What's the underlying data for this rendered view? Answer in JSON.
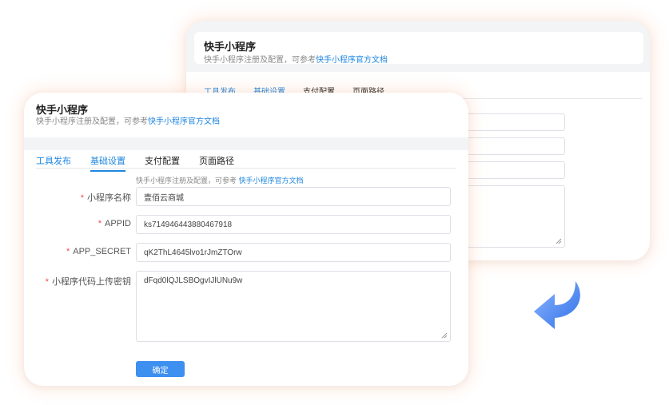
{
  "back_panel": {
    "title": "快手小程序",
    "subtitle_text": "快手小程序注册及配置，可参考",
    "subtitle_link": "快手小程序官方文档",
    "tabs": [
      {
        "label": "工具发布",
        "active": true
      },
      {
        "label": "基础设置",
        "active": false
      },
      {
        "label": "支付配置",
        "active": false
      },
      {
        "label": "页面路径",
        "active": false
      }
    ]
  },
  "front_panel": {
    "title": "快手小程序",
    "subtitle_text": "快手小程序注册及配置，可参考",
    "subtitle_link": "快手小程序官方文档",
    "tabs": [
      {
        "label": "工具发布",
        "active": false
      },
      {
        "label": "基础设置",
        "active": true
      },
      {
        "label": "支付配置",
        "active": false
      },
      {
        "label": "页面路径",
        "active": false
      }
    ],
    "hint_text": "快手小程序注册及配置，可参考",
    "hint_link": "快手小程序官方文档",
    "form": {
      "name_label": "小程序名称",
      "name_value": "壹佰云商城",
      "appid_label": "APPID",
      "appid_value": "ks714946443880467918",
      "secret_label": "APP_SECRET",
      "secret_value": "qK2ThL4645lvo1rJmZTOrw",
      "upload_key_label": "小程序代码上传密钥",
      "upload_key_value": "dFqd0lQJLSBOgvIJlUNu9w",
      "required_mark": "*"
    },
    "confirm_label": "确定"
  },
  "colors": {
    "accent": "#1e86e0",
    "button": "#3d8ff0",
    "required": "#f04b4b",
    "arrow": "#3b7ef5"
  },
  "decor": {
    "arrow_icon": "curved-arrow-left-icon"
  }
}
